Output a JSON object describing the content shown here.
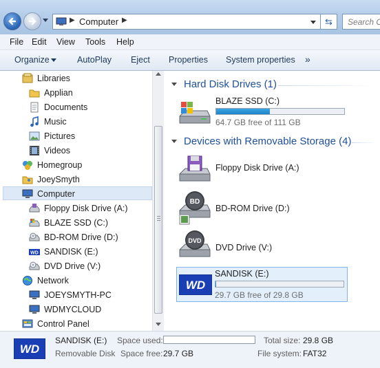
{
  "address": {
    "location": "Computer",
    "search_placeholder": "Search C"
  },
  "menu": [
    "File",
    "Edit",
    "View",
    "Tools",
    "Help"
  ],
  "toolbar": {
    "organize": "Organize",
    "autoplay": "AutoPlay",
    "eject": "Eject",
    "properties": "Properties",
    "system_properties": "System properties",
    "more": "»"
  },
  "nav": {
    "items": [
      {
        "label": "Libraries",
        "icon": "libraries-icon"
      },
      {
        "label": "Applian",
        "icon": "folder-icon"
      },
      {
        "label": "Documents",
        "icon": "documents-icon"
      },
      {
        "label": "Music",
        "icon": "music-icon"
      },
      {
        "label": "Pictures",
        "icon": "pictures-icon"
      },
      {
        "label": "Videos",
        "icon": "videos-icon"
      },
      {
        "label": "Homegroup",
        "icon": "homegroup-icon"
      },
      {
        "label": "JoeySmyth",
        "icon": "user-folder-icon"
      },
      {
        "label": "Computer",
        "icon": "computer-icon",
        "selected": true
      },
      {
        "label": "Floppy Disk Drive (A:)",
        "icon": "floppy-drive-icon"
      },
      {
        "label": "BLAZE SSD (C:)",
        "icon": "windows-drive-icon"
      },
      {
        "label": "BD-ROM Drive (D:)",
        "icon": "bd-rom-drive-icon"
      },
      {
        "label": "SANDISK (E:)",
        "icon": "wd-drive-icon"
      },
      {
        "label": "DVD Drive (V:)",
        "icon": "dvd-drive-icon"
      },
      {
        "label": "Network",
        "icon": "network-icon"
      },
      {
        "label": "JOEYSMYTH-PC",
        "icon": "computer-icon"
      },
      {
        "label": "WDMYCLOUD",
        "icon": "computer-icon"
      },
      {
        "label": "Control Panel",
        "icon": "control-panel-icon"
      }
    ]
  },
  "content": {
    "hard_disk_heading": "Hard Disk Drives (1)",
    "removable_heading": "Devices with Removable Storage (4)",
    "hard_drives": [
      {
        "name": "BLAZE SSD (C:)",
        "free_text": "64.7 GB free of 111 GB",
        "used_fraction": 0.417
      }
    ],
    "removable": [
      {
        "name": "Floppy Disk Drive (A:)"
      },
      {
        "name": "BD-ROM Drive (D:)"
      },
      {
        "name": "DVD Drive (V:)"
      },
      {
        "name": "SANDISK (E:)",
        "free_text": "29.7 GB free of 29.8 GB",
        "used_fraction": 0.003
      }
    ]
  },
  "details": {
    "name": "SANDISK (E:)",
    "type": "Removable Disk",
    "space_used_label": "Space used:",
    "space_free_label": "Space free:",
    "space_free_value": "29.7 GB",
    "total_size_label": "Total size:",
    "total_size_value": "29.8 GB",
    "file_system_label": "File system:",
    "file_system_value": "FAT32",
    "used_fraction": 0.003
  },
  "colors": {
    "heading_blue": "#1e4f9c",
    "progress_blue": "#2a8fd4",
    "selection_bg": "#cce4f7",
    "wd_blue": "#1a3fb5"
  }
}
